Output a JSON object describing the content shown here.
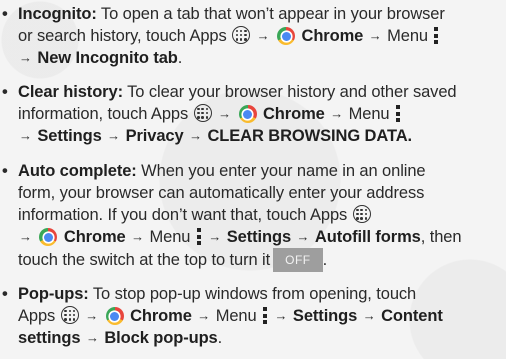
{
  "bullet": "•",
  "arrow": "→",
  "items": [
    {
      "lines": [
        [
          "Incognito:",
          " To open a tab that won’t appear in your browser"
        ],
        [
          "or search history, touch Apps",
          "Chrome",
          "Menu"
        ],
        [
          "New Incognito tab",
          "."
        ]
      ]
    },
    {
      "lines": [
        [
          "Clear history:",
          " To clear your browser history and other saved"
        ],
        [
          "information, touch Apps",
          "Chrome",
          "Menu"
        ],
        [
          "Settings",
          "Privacy",
          "CLEAR BROWSING DATA."
        ]
      ]
    },
    {
      "lines": [
        [
          "Auto complete:",
          " When you enter your name in an online"
        ],
        [
          "form, your browser can automatically enter your address"
        ],
        [
          "information. If you don’t want that, touch Apps"
        ],
        [
          "Chrome",
          "Menu",
          "Settings",
          "Autofill forms",
          ", then"
        ],
        [
          "touch the switch at the top to turn it",
          "OFF",
          "."
        ]
      ]
    },
    {
      "lines": [
        [
          "Pop-ups:",
          " To stop pop-up windows from opening, touch"
        ],
        [
          "Apps",
          "Chrome",
          "Menu",
          "Settings",
          "Content"
        ],
        [
          "settings",
          "Block pop-ups",
          "."
        ]
      ]
    }
  ]
}
